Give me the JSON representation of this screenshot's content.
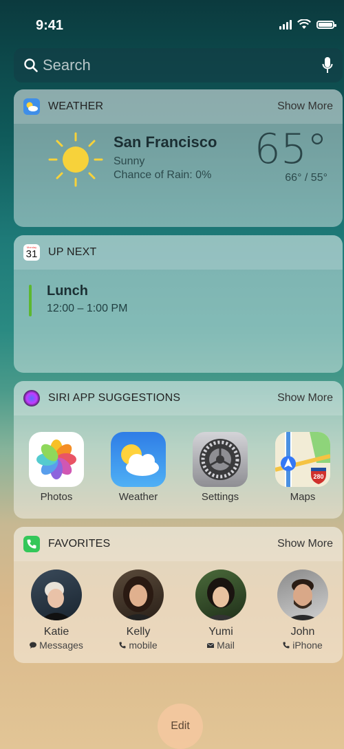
{
  "status_bar": {
    "time": "9:41"
  },
  "search": {
    "placeholder": "Search"
  },
  "weather_widget": {
    "title": "WEATHER",
    "show_more": "Show More",
    "city": "San Francisco",
    "condition": "Sunny",
    "rain": "Chance of Rain: 0%",
    "temperature": "65°",
    "hilo": "66° / 55°",
    "icon": "sun-icon"
  },
  "upnext_widget": {
    "title": "UP NEXT",
    "calendar_icon_day_label": "Monday",
    "calendar_icon_date": "31",
    "event": {
      "title": "Lunch",
      "time": "12:00 – 1:00 PM",
      "accent": "#5cb82f"
    }
  },
  "siri_widget": {
    "title": "SIRI APP SUGGESTIONS",
    "show_more": "Show More",
    "apps": [
      {
        "label": "Photos",
        "icon": "photos-icon"
      },
      {
        "label": "Weather",
        "icon": "weather-app-icon"
      },
      {
        "label": "Settings",
        "icon": "settings-gear-icon"
      },
      {
        "label": "Maps",
        "icon": "maps-icon",
        "badge": "280"
      }
    ]
  },
  "favorites_widget": {
    "title": "FAVORITES",
    "show_more": "Show More",
    "contacts": [
      {
        "name": "Katie",
        "method": "Messages",
        "method_icon": "message-bubble-icon"
      },
      {
        "name": "Kelly",
        "method": "mobile",
        "method_icon": "phone-icon"
      },
      {
        "name": "Yumi",
        "method": "Mail",
        "method_icon": "mail-envelope-icon"
      },
      {
        "name": "John",
        "method": "iPhone",
        "method_icon": "phone-icon"
      }
    ]
  },
  "edit_button": {
    "label": "Edit"
  },
  "colors": {
    "weather_blue": "#3f8ee8",
    "phone_green": "#34c759",
    "event_green": "#5cb82f"
  }
}
